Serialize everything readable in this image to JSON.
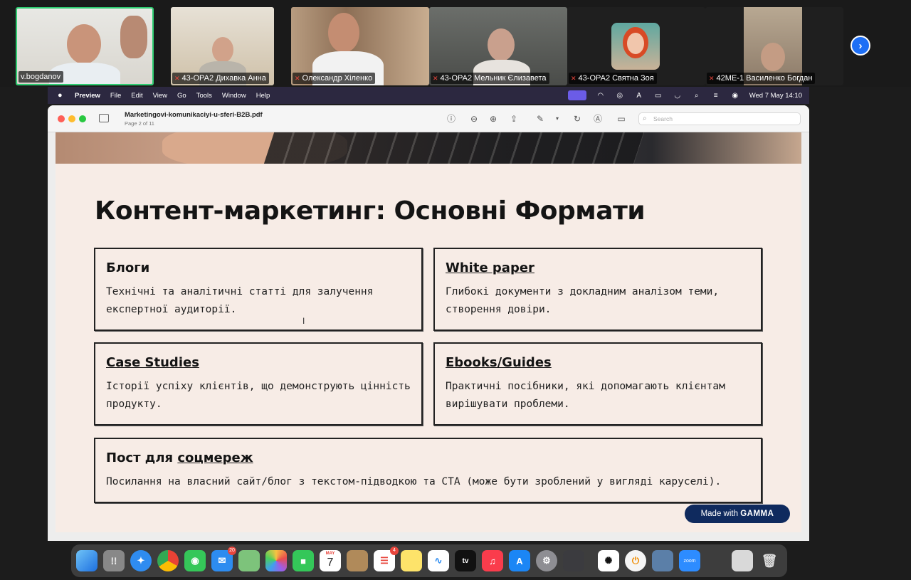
{
  "participants": [
    {
      "name": "v.bogdanov",
      "muted": false
    },
    {
      "name": "43-ОРА2 Дихавка Анна",
      "muted": true
    },
    {
      "name": "Олександр Хіленко",
      "muted": true
    },
    {
      "name": "43-ОРА2 Мельник Єлизавета",
      "muted": true
    },
    {
      "name": "43-ОРА2 Святна Зоя",
      "muted": true
    },
    {
      "name": "42МЕ-1 Василенко Богдан",
      "muted": true
    }
  ],
  "menubar": {
    "app": "Preview",
    "items": [
      "File",
      "Edit",
      "View",
      "Go",
      "Tools",
      "Window",
      "Help"
    ],
    "clock": "Wed 7 May  14:10"
  },
  "preview": {
    "filename": "Marketingovi-komunikaciyi-u-sferi-B2B.pdf",
    "page_info": "Page 2 of 11",
    "search_placeholder": "Search"
  },
  "slide": {
    "title": "Контент-маркетинг: Основні Формати",
    "cards": [
      {
        "title": "Блоги",
        "text": "Технічні та аналітичні статті для залучення експертної аудиторії."
      },
      {
        "title": "White paper",
        "text": "Глибокі документи з докладним аналізом теми, створення довіри."
      },
      {
        "title": "Case Studies",
        "text": "Історії успіху клієнтів, що демонструють цінність продукту."
      },
      {
        "title": "Ebooks/Guides",
        "text": "Практичні посібники, які допомагають клієнтам вирішувати проблеми."
      },
      {
        "title_plain": "Пост для ",
        "title_link": "соцмереж",
        "text": "Посилання на власний сайт/блог з текстом-підводкою та CTA (може бути зроблений у вигляді каруселі)."
      }
    ],
    "badge_prefix": "Made with",
    "badge_brand": "GAMMA"
  },
  "dock": {
    "mail_badge": "20",
    "calendar_month": "MAY",
    "calendar_day": "7",
    "reminders_badge": "4",
    "tv_label": "tv",
    "zoom_label": "zoom"
  }
}
